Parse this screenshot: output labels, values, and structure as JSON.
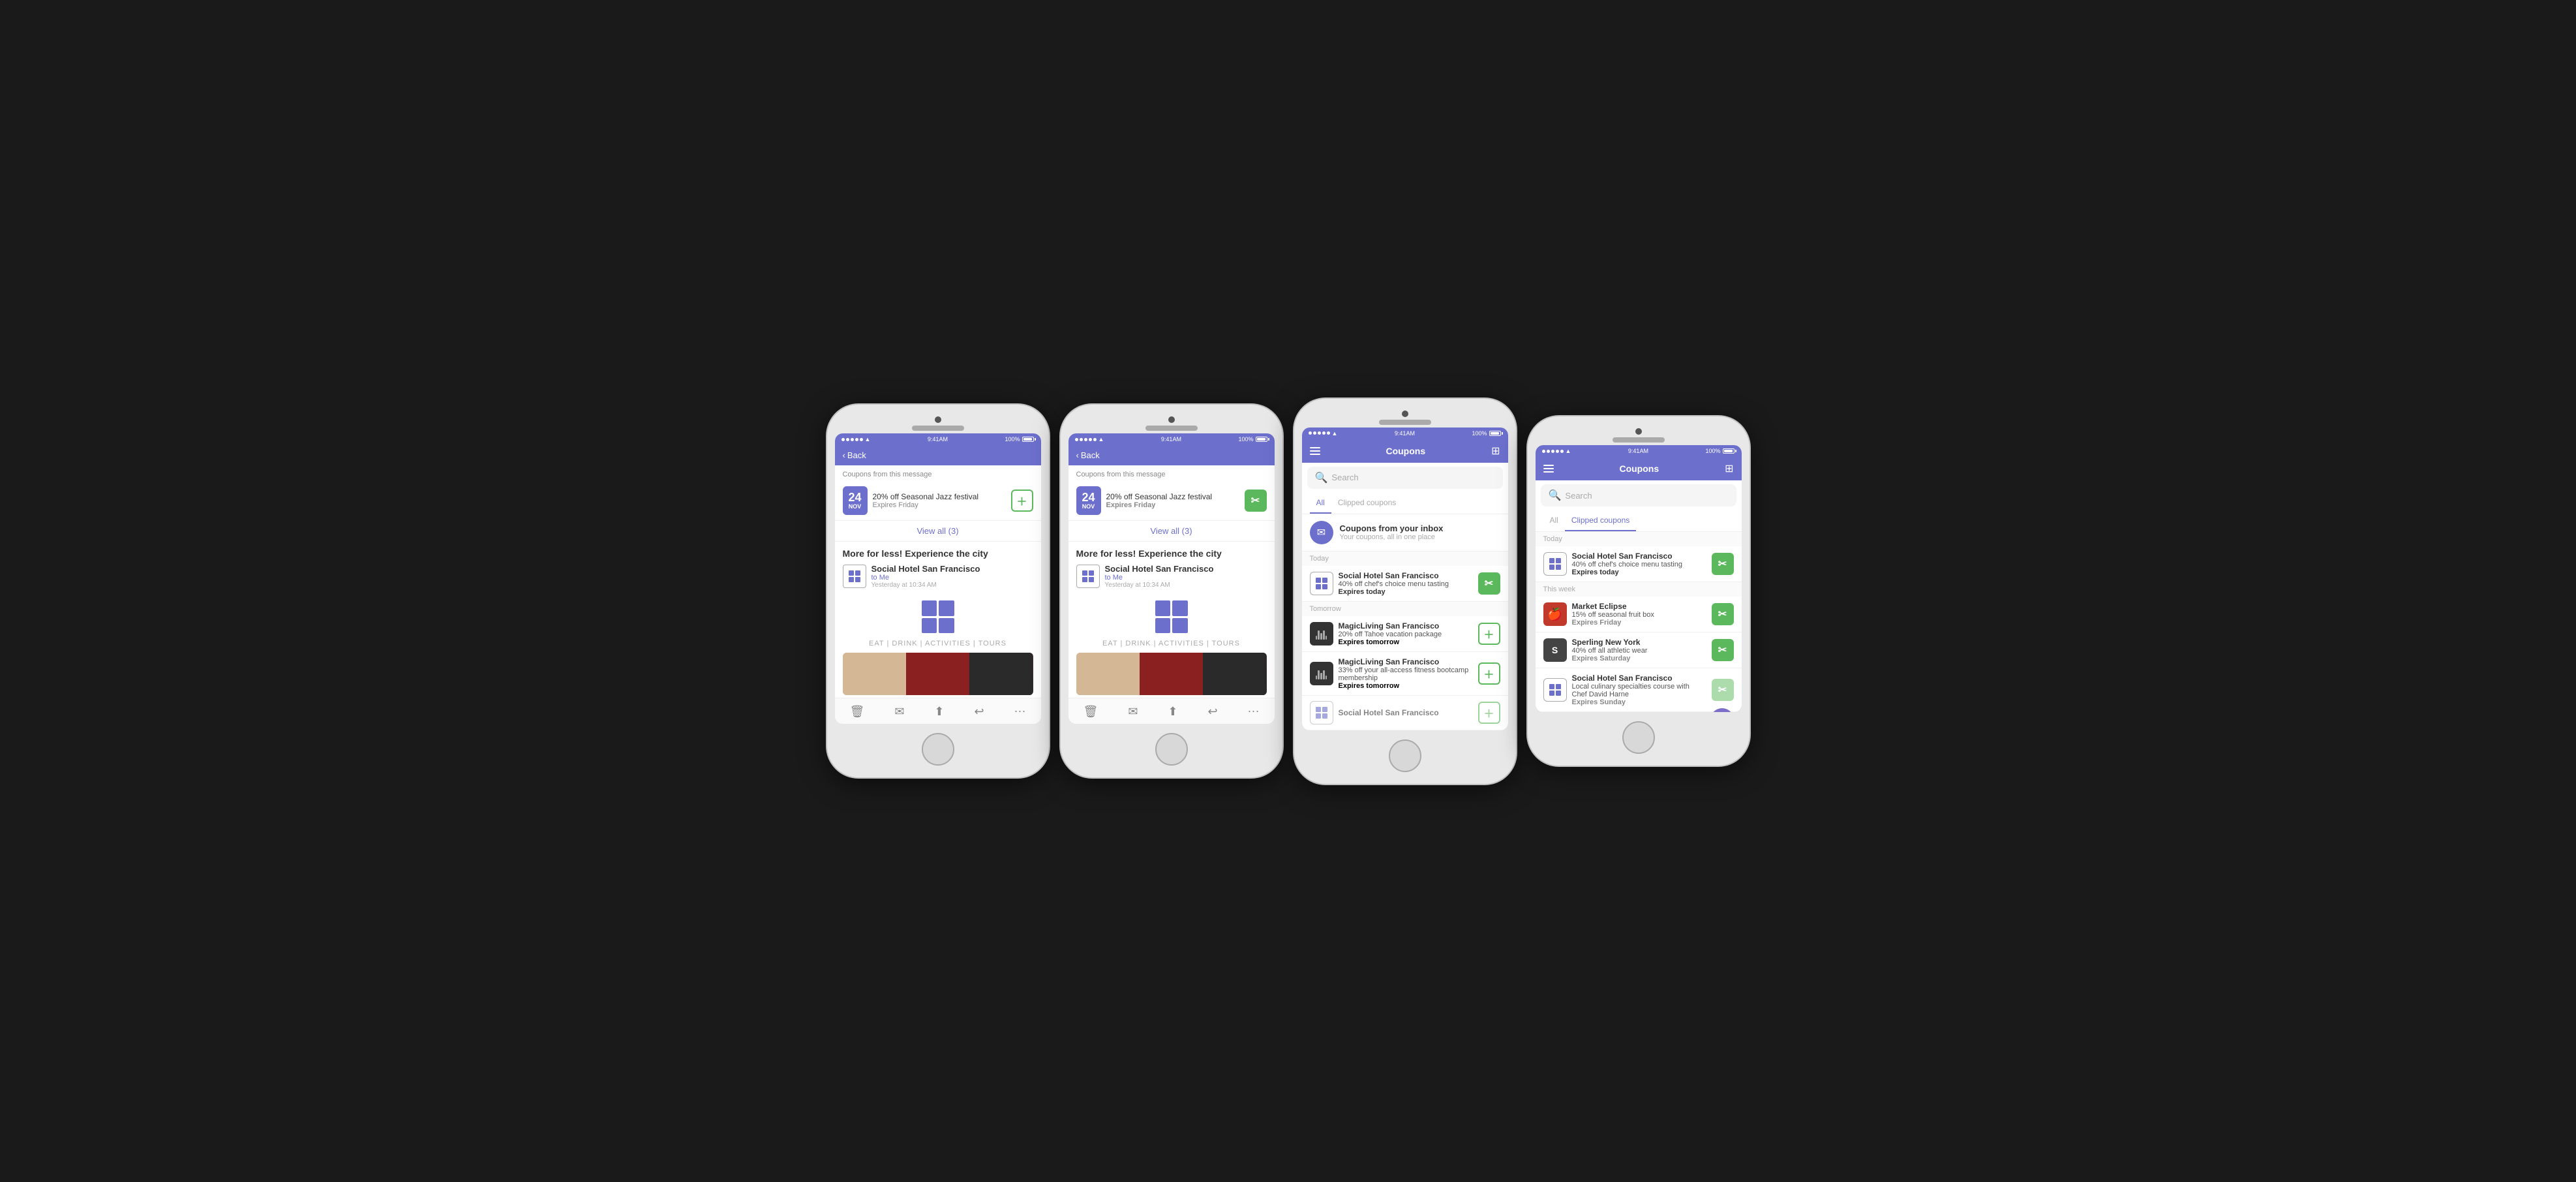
{
  "phones": [
    {
      "id": "phone1",
      "status": {
        "time": "9:41AM",
        "battery": "100%",
        "signal": "●●●●●",
        "wifi": "wifi"
      },
      "header": {
        "back_label": "Back",
        "type": "back"
      },
      "coupons_section_label": "Coupons from this message",
      "coupon": {
        "date_num": "24",
        "date_month": "NOV",
        "title": "20% off Seasonal Jazz festival",
        "expires": "Expires Friday",
        "btn_type": "add"
      },
      "view_all": "View all (3)",
      "more_title": "More for less! Experience the city",
      "message": {
        "brand": "Social Hotel San Francisco",
        "to": "to Me",
        "time": "Yesterday at 10:34 AM"
      },
      "eat_label": "EAT | DRINK | ACTIVITIES | TOURS",
      "toolbar_icons": [
        "🗑",
        "✉",
        "↑",
        "↩",
        "···"
      ]
    },
    {
      "id": "phone2",
      "status": {
        "time": "9:41AM",
        "battery": "100%"
      },
      "header": {
        "back_label": "Back",
        "type": "back"
      },
      "coupons_section_label": "Coupons from this message",
      "coupon": {
        "date_num": "24",
        "date_month": "NOV",
        "title": "20% off Seasonal Jazz festival",
        "expires": "Expires Friday",
        "expires_bold": true,
        "btn_type": "clip"
      },
      "view_all": "View all (3)",
      "more_title": "More for less! Experience the city",
      "message": {
        "brand": "Social Hotel San Francisco",
        "to": "to Me",
        "time": "Yesterday at 10:34 AM"
      },
      "eat_label": "EAT | DRINK | ACTIVITIES | TOURS",
      "toolbar_icons": [
        "🗑",
        "✉",
        "↑",
        "↩",
        "···"
      ]
    },
    {
      "id": "phone3",
      "status": {
        "time": "9:41AM",
        "battery": "100%"
      },
      "header": {
        "type": "coupons",
        "title": "Coupons"
      },
      "search_placeholder": "Search",
      "tabs": [
        {
          "label": "All",
          "active": true
        },
        {
          "label": "Clipped coupons",
          "active": false
        }
      ],
      "inbox": {
        "title": "Coupons from your inbox",
        "subtitle": "Your coupons, all in one place"
      },
      "date_sections": [
        {
          "label": "Today",
          "coupons": [
            {
              "brand": "Social Hotel San Francisco",
              "desc": "40% off chef's choice menu tasting",
              "expires": "Expires today",
              "btn_type": "clip",
              "avatar_type": "grid"
            }
          ]
        },
        {
          "label": "Tomorrow",
          "coupons": [
            {
              "brand": "MagicLiving San Francisco",
              "desc": "20% off Tahoe vacation package",
              "expires": "Expires tomorrow",
              "btn_type": "add",
              "avatar_type": "music"
            },
            {
              "brand": "MagicLiving San Francisco",
              "desc": "33% off your all-access fitness bootcamp membership",
              "expires": "Expires tomorrow",
              "btn_type": "add",
              "avatar_type": "music"
            }
          ]
        },
        {
          "label": "",
          "coupons": [
            {
              "brand": "Social Hotel San Francisco",
              "desc": "",
              "expires": "",
              "btn_type": "add",
              "avatar_type": "grid"
            }
          ]
        }
      ]
    },
    {
      "id": "phone4",
      "status": {
        "time": "9:41AM",
        "battery": "100%"
      },
      "header": {
        "type": "coupons",
        "title": "Coupons"
      },
      "search_placeholder": "Search",
      "tabs": [
        {
          "label": "All",
          "active": false
        },
        {
          "label": "Clipped coupons",
          "active": true
        }
      ],
      "date_sections": [
        {
          "label": "Today",
          "coupons": [
            {
              "brand": "Social Hotel San Francisco",
              "desc": "40% off chef's choice menu tasting",
              "expires": "Expires today",
              "btn_type": "clip",
              "avatar_type": "grid"
            }
          ]
        },
        {
          "label": "This week",
          "coupons": [
            {
              "brand": "Market Eclipse",
              "desc": "15% off seasonal fruit box",
              "expires": "Expires Friday",
              "btn_type": "clip",
              "avatar_type": "red",
              "avatar_letter": "🍎"
            },
            {
              "brand": "Sperling New York",
              "desc": "40% off all athletic wear",
              "expires": "Expires Saturday",
              "btn_type": "clip",
              "avatar_type": "dark-s",
              "avatar_letter": "S"
            },
            {
              "brand": "Social Hotel San Francisco",
              "desc": "Local culinary specialties course with Chef David Harne",
              "expires": "Expires Sunday",
              "btn_type": "clip_partial",
              "avatar_type": "grid"
            }
          ]
        }
      ]
    }
  ],
  "labels": {
    "back": "Back",
    "search": "Search",
    "coupons": "Coupons",
    "all": "All",
    "clipped_coupons": "Clipped coupons",
    "all_clipped": "All Clipped coupons",
    "today": "Today",
    "tomorrow": "Tomorrow",
    "this_week": "This week",
    "view_all_3": "View all (3)",
    "coupons_from_message": "Coupons from this message",
    "more_title": "More for less! Experience the city",
    "social_hotel": "Social Hotel San Francisco",
    "to_me": "to Me",
    "yesterday": "Yesterday at 10:34 AM",
    "eat": "EAT | DRINK | ACTIVITIES | TOURS",
    "jazz": "20% off Seasonal Jazz festival",
    "expires_friday": "Expires Friday",
    "inbox_title": "Coupons from your inbox",
    "inbox_sub": "Your coupons, all in one place",
    "shsf_desc": "40% off chef's choice menu tasting",
    "expires_today": "Expires today",
    "magic_brand": "MagicLiving San Francisco",
    "magic_desc1": "20% off Tahoe vacation package",
    "expires_tomorrow": "Expires tomorrow",
    "magic_desc2": "33% off your all-access fitness bootcamp membership",
    "market_brand": "Market Eclipse",
    "market_desc": "15% off seasonal fruit box",
    "sperling_brand": "Sperling New York",
    "sperling_desc": "40% off all athletic wear",
    "expires_saturday": "Expires Saturday",
    "shsf_desc4": "Local culinary specialties course with Chef David Harne",
    "expires_sunday": "Expires Sunday"
  }
}
